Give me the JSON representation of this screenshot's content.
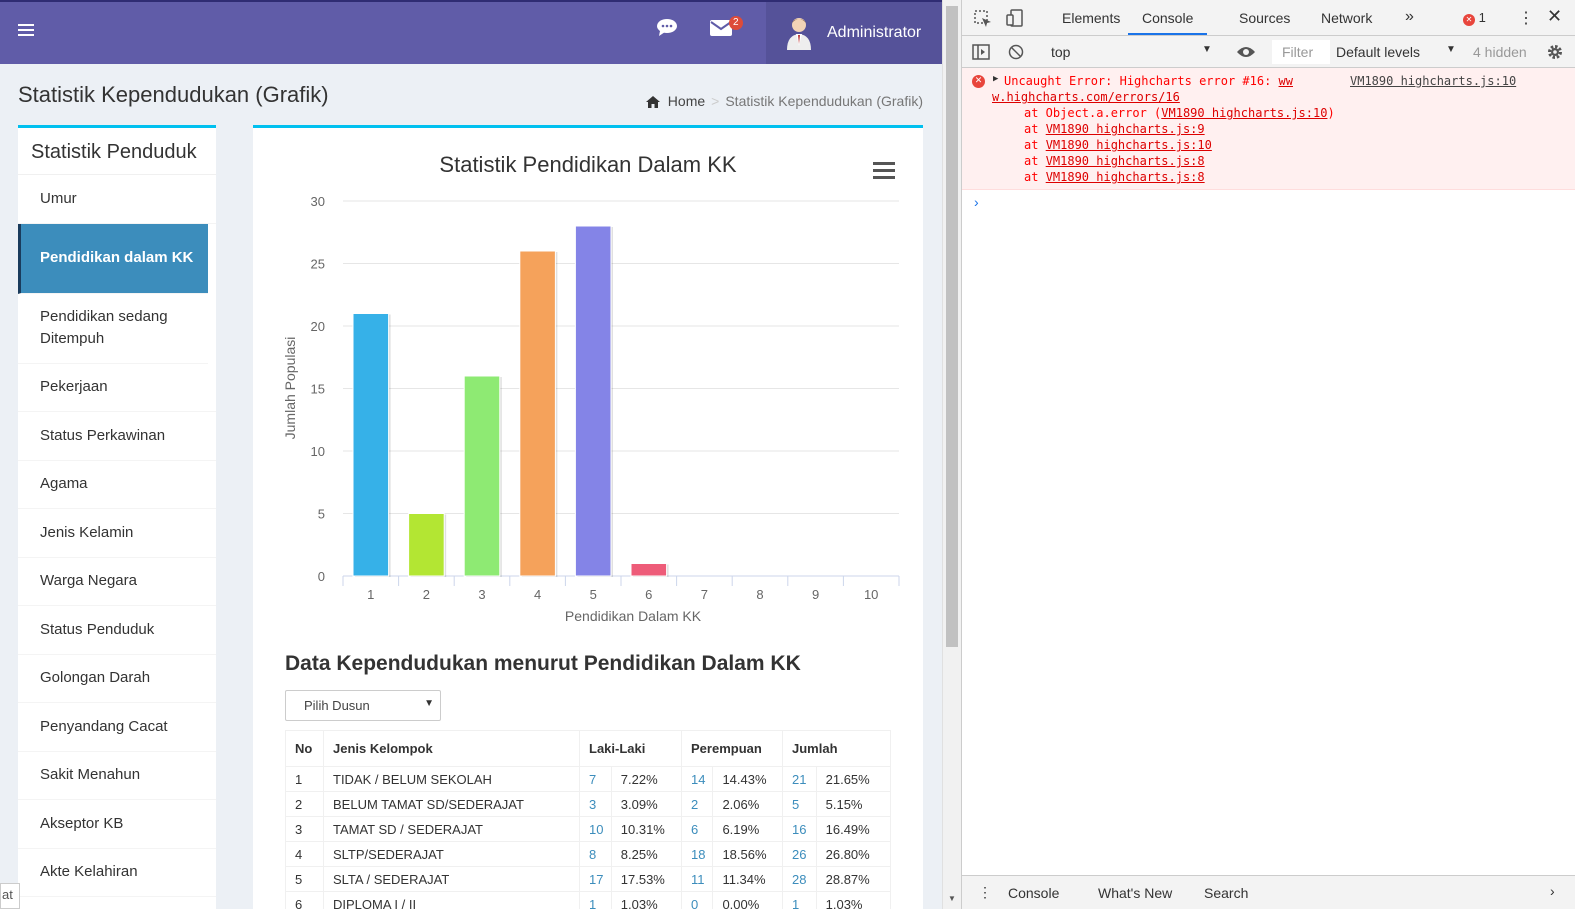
{
  "header": {
    "user_name": "Administrator",
    "mail_count": "2",
    "brand_color": "#605ca8"
  },
  "page": {
    "title": "Statistik Kependudukan (Grafik)",
    "breadcrumb_home": "Home",
    "breadcrumb_current": "Statistik Kependudukan (Grafik)"
  },
  "sidebar": {
    "title": "Statistik Penduduk",
    "items": [
      {
        "label": "Umur"
      },
      {
        "label": "Pendidikan dalam KK"
      },
      {
        "label": "Pendidikan sedang Ditempuh"
      },
      {
        "label": "Pekerjaan"
      },
      {
        "label": "Status Perkawinan"
      },
      {
        "label": "Agama"
      },
      {
        "label": "Jenis Kelamin"
      },
      {
        "label": "Warga Negara"
      },
      {
        "label": "Status Penduduk"
      },
      {
        "label": "Golongan Darah"
      },
      {
        "label": "Penyandang Cacat"
      },
      {
        "label": "Sakit Menahun"
      },
      {
        "label": "Akseptor KB"
      },
      {
        "label": "Akte Kelahiran"
      }
    ],
    "active_index": 1
  },
  "chart_data": {
    "type": "bar",
    "title": "Statistik Pendidikan Dalam KK",
    "xlabel": "Pendidikan Dalam KK",
    "ylabel": "Jumlah Populasi",
    "categories": [
      "1",
      "2",
      "3",
      "4",
      "5",
      "6",
      "7",
      "8",
      "9",
      "10"
    ],
    "values": [
      21,
      5,
      16,
      26,
      28,
      1,
      0,
      0,
      0,
      0
    ],
    "colors": [
      "#36b1e8",
      "#b3e633",
      "#8eea73",
      "#f5a25b",
      "#8484e7",
      "#ee5c79",
      "#aaaaaa",
      "#aaaaaa",
      "#aaaaaa",
      "#aaaaaa"
    ],
    "ylim": [
      0,
      30
    ],
    "yticks": [
      0,
      5,
      10,
      15,
      20,
      25,
      30
    ],
    "grid": true
  },
  "data_section": {
    "title": "Data Kependudukan menurut Pendidikan Dalam KK",
    "select_label": "Pilih Dusun",
    "columns": [
      "No",
      "Jenis Kelompok",
      "Laki-Laki",
      "Perempuan",
      "Jumlah"
    ],
    "rows": [
      [
        "1",
        "TIDAK / BELUM SEKOLAH",
        "7",
        "7.22%",
        "14",
        "14.43%",
        "21",
        "21.65%"
      ],
      [
        "2",
        "BELUM TAMAT SD/SEDERAJAT",
        "3",
        "3.09%",
        "2",
        "2.06%",
        "5",
        "5.15%"
      ],
      [
        "3",
        "TAMAT SD / SEDERAJAT",
        "10",
        "10.31%",
        "6",
        "6.19%",
        "16",
        "16.49%"
      ],
      [
        "4",
        "SLTP/SEDERAJAT",
        "8",
        "8.25%",
        "18",
        "18.56%",
        "26",
        "26.80%"
      ],
      [
        "5",
        "SLTA / SEDERAJAT",
        "17",
        "17.53%",
        "11",
        "11.34%",
        "28",
        "28.87%"
      ],
      [
        "6",
        "DIPLOMA I / II",
        "1",
        "1.03%",
        "0",
        "0.00%",
        "1",
        "1.03%"
      ]
    ]
  },
  "devtools": {
    "tabs": [
      "Elements",
      "Console",
      "Sources",
      "Network"
    ],
    "active_tab": "Console",
    "error_count": "1",
    "context": "top",
    "filter_placeholder": "Filter",
    "levels": "Default levels",
    "hidden": "4 hidden",
    "error_lines": [
      "Uncaught Error: Highcharts error #16: ",
      "at Object.a.error (",
      "at ",
      "at ",
      "at ",
      "at "
    ],
    "error_link_head": "ww",
    "error_link_tail": "w.highcharts.com/errors/16",
    "error_source": "VM1890 highcharts.js:10",
    "stack_links": [
      "VM1890 highcharts.js:10",
      "VM1890 highcharts.js:9",
      "VM1890 highcharts.js:10",
      "VM1890 highcharts.js:8",
      "VM1890 highcharts.js:8"
    ],
    "drawer_tabs": [
      "Console",
      "What's New",
      "Search"
    ],
    "prompt": "›"
  },
  "edge_text": "at"
}
